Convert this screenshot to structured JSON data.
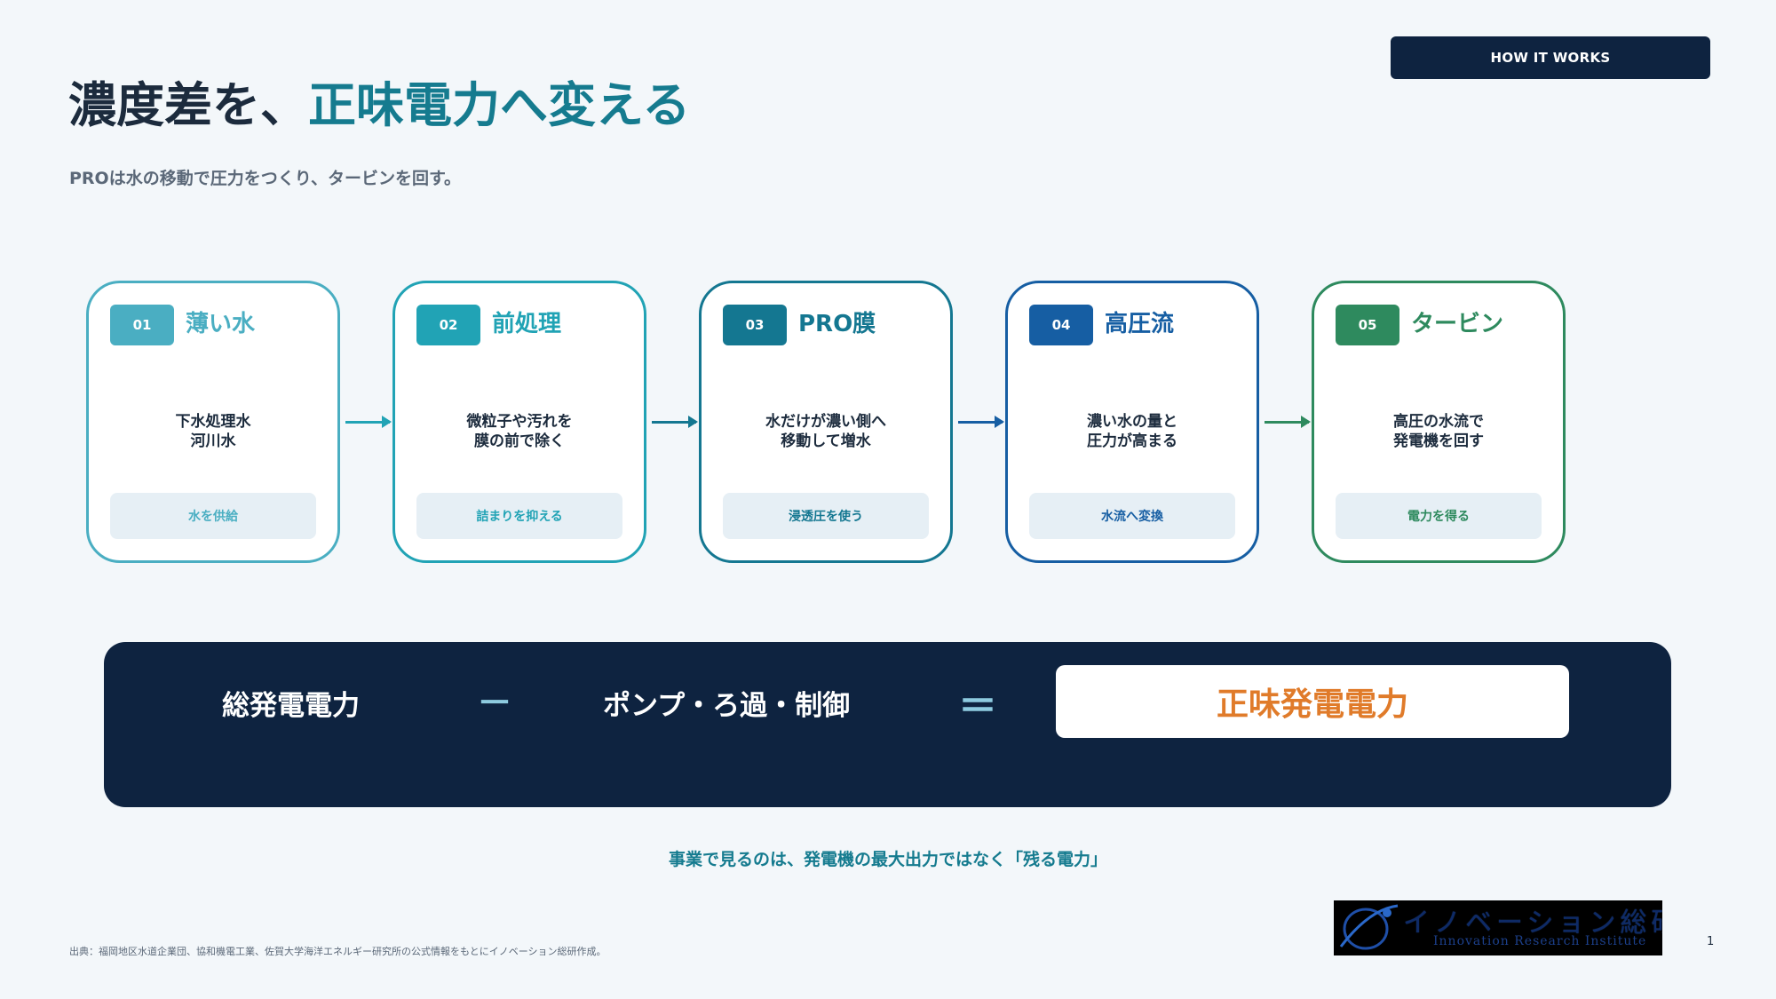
{
  "header": {
    "badge": "HOW IT WORKS",
    "title_main": "濃度差を、",
    "title_accent": "正味電力へ変える",
    "subtitle": "PROは水の移動で圧力をつくり、タービンを回す。"
  },
  "steps": [
    {
      "num": "01",
      "name": "薄い水",
      "desc": "下水処理水\n河川水",
      "action": "水を供給",
      "color": "#4aaec2"
    },
    {
      "num": "02",
      "name": "前処理",
      "desc": "微粒子や汚れを\n膜の前で除く",
      "action": "詰まりを抑える",
      "color": "#21a3b5"
    },
    {
      "num": "03",
      "name": "PRO膜",
      "desc": "水だけが濃い側へ\n移動して増水",
      "action": "浸透圧を使う",
      "color": "#147791"
    },
    {
      "num": "04",
      "name": "高圧流",
      "desc": "濃い水の量と\n圧力が高まる",
      "action": "水流へ変換",
      "color": "#165ea3"
    },
    {
      "num": "05",
      "name": "タービン",
      "desc": "高圧の水流で\n発電機を回す",
      "action": "電力を得る",
      "color": "#2e8a5e"
    }
  ],
  "formula": {
    "total": "総発電電力",
    "minus": "－",
    "loss": "ポンプ・ろ過・制御",
    "equals": "＝",
    "result": "正味発電電力"
  },
  "note": "事業で見るのは、発電機の最大出力ではなく「残る電力」",
  "source": "出典：福岡地区水道企業団、協和機電工業、佐賀大学海洋エネルギー研究所の公式情報をもとにイノベーション総研作成。",
  "logo": {
    "jp": "イノベーション総研",
    "en": "Innovation Research Institute"
  },
  "page_number": "1"
}
